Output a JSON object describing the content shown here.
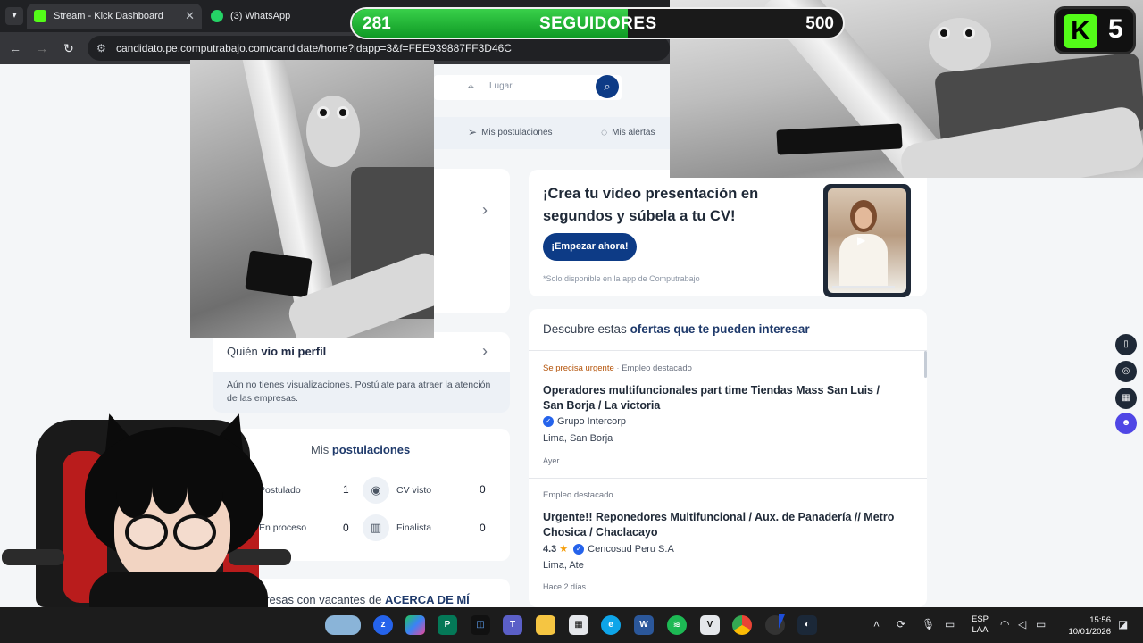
{
  "browser": {
    "tabs": [
      {
        "title": "Stream - Kick Dashboard",
        "color": "#53fc18"
      },
      {
        "title": "(3) WhatsApp",
        "color": "#25d366"
      }
    ],
    "url": "candidato.pe.computrabajo.com/candidate/home?idapp=3&f=FEE939887FF3D46C"
  },
  "header": {
    "location_placeholder": "Lugar",
    "nav": [
      "Mis postulaciones",
      "Mis alertas"
    ]
  },
  "profile_views": {
    "title_prefix": "Quién",
    "title_bold": "vio mi perfil",
    "note": "Aún no tienes visualizaciones. Postúlate para atraer la atención de las empresas."
  },
  "applications": {
    "title_prefix": "Mis",
    "title_bold": "postulaciones",
    "stats": [
      {
        "label": "Postulado",
        "value": "1",
        "icon": "check-circle-icon"
      },
      {
        "label": "CV visto",
        "value": "0",
        "icon": "eye-icon"
      },
      {
        "label": "En proceso",
        "value": "0",
        "icon": "clipboard-icon"
      },
      {
        "label": "Finalista",
        "value": "0",
        "icon": "podium-icon"
      }
    ]
  },
  "companies": {
    "text_prefix": "presas con vacantes de",
    "text_bold": "ACERCA DE MÍ"
  },
  "promo": {
    "title": "¡Crea tu video presentación en segundos y súbela a tu CV!",
    "button": "¡Empezar ahora!",
    "note": "*Solo disponible en la app de Computrabajo"
  },
  "offers": {
    "heading_prefix": "Descubre estas",
    "heading_bold": "ofertas que te pueden interesar",
    "jobs": [
      {
        "urgent": "Se precisa urgente",
        "featured": "Empleo destacado",
        "title": "Operadores multifuncionales part time Tiendas Mass San Luis / San Borja / La victoria",
        "rating": "",
        "company": "Grupo Intercorp",
        "location": "Lima, San Borja",
        "posted": "Ayer"
      },
      {
        "urgent": "",
        "featured": "Empleo destacado",
        "title": "Urgente!! Reponedores Multifuncional / Aux. de Panadería // Metro Chosica / Chaclacayo",
        "rating": "4.3",
        "company": "Cencosud Peru S.A",
        "location": "Lima, Ate",
        "posted": "Hace 2 días"
      }
    ]
  },
  "stream_overlay": {
    "followers_current": "281",
    "followers_label": "SEGUIDORES",
    "followers_goal": "500",
    "followers_progress": 0.562,
    "badge_letter": "K",
    "badge_number": "5",
    "accent": "#53fc18"
  },
  "taskbar": {
    "language": "ESP",
    "layout": "LAA",
    "time": "15:56",
    "date": "10/01/2026"
  }
}
